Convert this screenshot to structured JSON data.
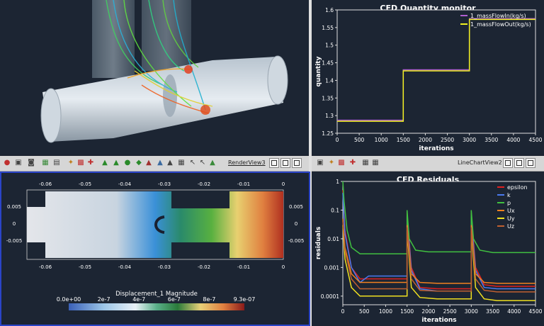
{
  "toolbars": {
    "left": {
      "view_label": "RenderView3"
    },
    "right": {
      "view_label": "LineChartView2"
    }
  },
  "colors": {
    "active_border": "#2a44c8",
    "panel_bg": "#1c2533"
  },
  "colorbar": {
    "title": "Displacement_1 Magnitude",
    "labels": [
      "0.0e+00",
      "2e-7",
      "4e-7",
      "6e-7",
      "8e-7",
      "9.3e-07"
    ]
  },
  "slice_axes": {
    "x_ticks": [
      "-0.06",
      "-0.05",
      "-0.04",
      "-0.03",
      "-0.02",
      "-0.01",
      "0"
    ],
    "y_ticks": [
      "0.005",
      "0",
      "-0.005"
    ]
  },
  "chart_data": [
    {
      "type": "line",
      "title": "CFD Quantity monitor",
      "xlabel": "iterations",
      "ylabel": "quantity",
      "xlim": [
        0,
        4500
      ],
      "ylim": [
        1.25,
        1.6
      ],
      "x_ticks": [
        "0",
        "500",
        "1000",
        "1500",
        "2000",
        "2500",
        "3000",
        "3500",
        "4000",
        "4500"
      ],
      "y_ticks": [
        "1.25",
        "1.3",
        "1.35",
        "1.4",
        "1.45",
        "1.5",
        "1.55",
        "1.6"
      ],
      "legend_position": "top-right",
      "series": [
        {
          "name": "1_massFlowIn(kg/s)",
          "color": "#b060d0",
          "x": [
            0,
            1500,
            1500,
            3000,
            3000,
            4500
          ],
          "y": [
            1.287,
            1.287,
            1.43,
            1.43,
            1.575,
            1.575
          ]
        },
        {
          "name": "1_massFlowOut(kg/s)",
          "color": "#f0f020",
          "x": [
            0,
            1500,
            1500,
            3000,
            3000,
            4500
          ],
          "y": [
            1.284,
            1.284,
            1.427,
            1.427,
            1.573,
            1.573
          ]
        }
      ]
    },
    {
      "type": "line",
      "title": "CFD Residuals",
      "xlabel": "iterations",
      "ylabel": "residuals",
      "log_scale_y": true,
      "xlim": [
        0,
        4500
      ],
      "ylim": [
        5e-05,
        1
      ],
      "x_ticks": [
        "0",
        "500",
        "1000",
        "1500",
        "2000",
        "2500",
        "3000",
        "3500",
        "4000",
        "4500"
      ],
      "y_ticks": [
        "1",
        "0.1",
        "0.01",
        "0.001",
        "0.0001"
      ],
      "legend_position": "top-right",
      "series": [
        {
          "name": "epsilon",
          "color": "#e02020",
          "x": [
            0,
            50,
            200,
            400,
            600,
            1500,
            1500,
            1600,
            1800,
            2200,
            3000,
            3000,
            3100,
            3300,
            3600,
            4500
          ],
          "y": [
            0.5,
            0.02,
            0.001,
            0.0004,
            0.0004,
            0.0004,
            0.08,
            0.001,
            0.0002,
            0.00018,
            0.00018,
            0.08,
            0.001,
            0.00025,
            0.00022,
            0.00022
          ]
        },
        {
          "name": "k",
          "color": "#4a7af0",
          "x": [
            0,
            50,
            200,
            400,
            600,
            1500,
            1500,
            1600,
            1800,
            2200,
            3000,
            3000,
            3100,
            3300,
            3600,
            4500
          ],
          "y": [
            0.4,
            0.015,
            0.001,
            0.0003,
            0.0005,
            0.0005,
            0.06,
            0.0008,
            0.00018,
            0.00015,
            0.00015,
            0.06,
            0.0008,
            0.0002,
            0.00018,
            0.00018
          ]
        },
        {
          "name": "p",
          "color": "#40c040",
          "x": [
            0,
            30,
            100,
            200,
            400,
            1500,
            1500,
            1550,
            1700,
            2000,
            3000,
            3000,
            3050,
            3200,
            3500,
            4500
          ],
          "y": [
            1,
            0.2,
            0.02,
            0.005,
            0.003,
            0.003,
            0.1,
            0.01,
            0.004,
            0.0035,
            0.0035,
            0.1,
            0.01,
            0.004,
            0.0033,
            0.0033
          ]
        },
        {
          "name": "Ux",
          "color": "#f08020",
          "x": [
            0,
            50,
            200,
            400,
            1500,
            1500,
            1600,
            1800,
            2200,
            3000,
            3000,
            3100,
            3300,
            3600,
            4500
          ],
          "y": [
            0.05,
            0.005,
            0.0006,
            0.0003,
            0.0003,
            0.03,
            0.0006,
            0.0003,
            0.00028,
            0.00028,
            0.03,
            0.0006,
            0.0003,
            0.00028,
            0.00028
          ]
        },
        {
          "name": "Uy",
          "color": "#f0e020",
          "x": [
            0,
            50,
            200,
            400,
            1500,
            1500,
            1600,
            1800,
            2200,
            3000,
            3000,
            3100,
            3300,
            3600,
            4500
          ],
          "y": [
            0.03,
            0.002,
            0.0002,
            0.0001,
            0.0001,
            0.02,
            0.0002,
            9e-05,
            8e-05,
            8e-05,
            0.02,
            0.0002,
            8e-05,
            7e-05,
            7e-05
          ]
        },
        {
          "name": "Uz",
          "color": "#c06030",
          "x": [
            0,
            50,
            200,
            400,
            1500,
            1500,
            1600,
            1800,
            2200,
            3000,
            3000,
            3100,
            3300,
            3600,
            4500
          ],
          "y": [
            0.04,
            0.004,
            0.0004,
            0.00018,
            0.00018,
            0.025,
            0.0004,
            0.00016,
            0.00015,
            0.00015,
            0.025,
            0.0004,
            0.00016,
            0.00014,
            0.00014
          ]
        }
      ]
    }
  ]
}
